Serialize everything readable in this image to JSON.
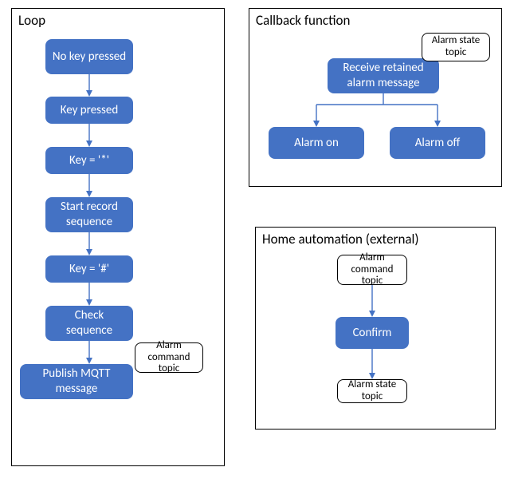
{
  "panels": {
    "loop": {
      "title": "Loop",
      "nodes": {
        "n1": "No key pressed",
        "n2": "Key pressed",
        "n3": "Key = '*'",
        "n4": "Start record sequence",
        "n5": "Key = '#'",
        "n6": "Check sequence",
        "n7": "Publish MQTT message"
      },
      "annot": "Alarm command topic"
    },
    "callback": {
      "title": "Callback function",
      "nodes": {
        "recv": "Receive retained alarm message",
        "on": "Alarm on",
        "off": "Alarm off"
      },
      "annot": "Alarm state topic"
    },
    "home": {
      "title": "Home automation (external)",
      "nodes": {
        "confirm": "Confirm"
      },
      "annotTop": "Alarm command topic",
      "annotBottom": "Alarm state topic"
    }
  },
  "colors": {
    "node": "#4472c4"
  }
}
